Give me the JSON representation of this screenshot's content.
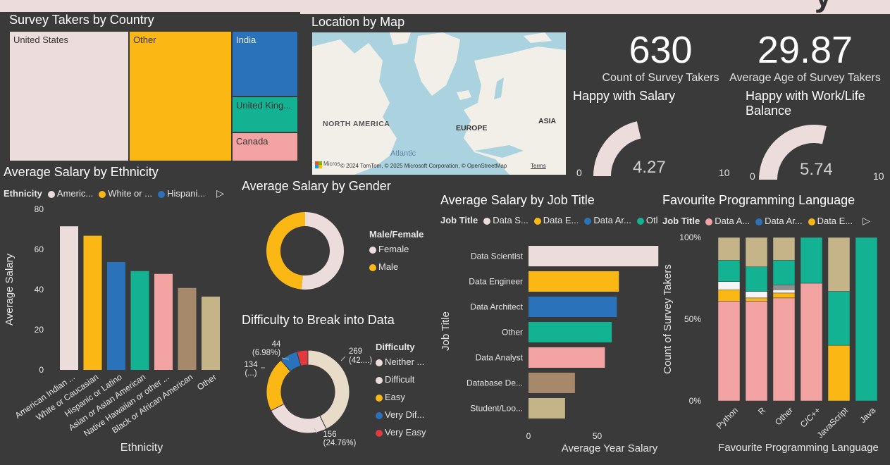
{
  "header": {
    "partial_title": "y"
  },
  "colors": {
    "c1": "#ecdcdc",
    "c2": "#fbb714",
    "c3": "#2a72ba",
    "c4": "#12b292",
    "c5": "#f4a3a3",
    "c6": "#a5896a",
    "c7": "#c5b487",
    "bg": "#3a3a3a"
  },
  "treemap": {
    "title": "Survey Takers by Country",
    "items": [
      "United States",
      "Other",
      "India",
      "United King...",
      "Canada"
    ]
  },
  "map": {
    "title": "Location by Map",
    "labels": [
      "NORTH AMERICA",
      "EUROPE",
      "ASIA",
      "Atlantic"
    ],
    "attribution": "© 2024 TomTom, © 2025 Microsoft Corporation, © OpenStreetMap",
    "terms": "Terms",
    "logo": "Micros"
  },
  "kpis": [
    {
      "value": "630",
      "label": "Count of Survey Takers"
    },
    {
      "value": "29.87",
      "label": "Average Age of Survey Takers"
    }
  ],
  "gauges": [
    {
      "title": "Happy with Salary",
      "value": 4.27,
      "value_text": "4.27",
      "min": "0",
      "max": "10"
    },
    {
      "title": "Happy with Work/Life Balance",
      "value": 5.74,
      "value_text": "5.74",
      "min": "0",
      "max": "10"
    }
  ],
  "ethnicity_chart": {
    "title": "Average Salary by Ethnicity",
    "legend_title": "Ethnicity",
    "legend_items": [
      "Americ...",
      "White or ...",
      "Hispani..."
    ],
    "xlabel": "Ethnicity",
    "ylabel": "Average Salary"
  },
  "gender_chart": {
    "title": "Average Salary by Gender",
    "legend_title": "Male/Female",
    "legend_items": [
      "Female",
      "Male"
    ]
  },
  "difficulty_chart": {
    "title": "Difficulty to Break into Data",
    "legend_title": "Difficulty",
    "legend_items": [
      "Neither ...",
      "Difficult",
      "Easy",
      "Very Dif...",
      "Very Easy"
    ],
    "labels": [
      "44",
      "(6.98%)",
      "134",
      "(...)",
      "269",
      "(42....)",
      "156",
      "(24.76%)"
    ]
  },
  "job_chart": {
    "title": "Average Salary by Job Title",
    "legend_title": "Job Title",
    "legend_items": [
      "Data S...",
      "Data E...",
      "Data Ar...",
      "Otl"
    ],
    "xlabel": "Average Year Salary",
    "ylabel": "Job Title"
  },
  "lang_chart": {
    "title": "Favourite Programming Language",
    "legend_title": "Job Title",
    "legend_items": [
      "Data A...",
      "Data Ar...",
      "Data E..."
    ],
    "xlabel": "Favourite Programming Language",
    "ylabel": "Count of Survey Takers"
  },
  "chart_data": [
    {
      "type": "bar",
      "title": "Average Salary by Ethnicity",
      "xlabel": "Ethnicity",
      "ylabel": "Average Salary",
      "ylim": [
        0,
        80
      ],
      "yticks": [
        0,
        20,
        40,
        60,
        80
      ],
      "categories": [
        "American Indian ...",
        "White or Caucasian",
        "Hispanic or Latino",
        "Asian or Asian American",
        "Native Hawaiian or other ...",
        "Black or African American",
        "Other"
      ],
      "values": [
        71.5,
        66.8,
        53.7,
        49.2,
        47.8,
        40.8,
        36.5
      ]
    },
    {
      "type": "pie",
      "title": "Average Salary by Gender",
      "categories": [
        "Female",
        "Male"
      ],
      "values": [
        51.5,
        48.5
      ]
    },
    {
      "type": "pie",
      "title": "Difficulty to Break into Data",
      "categories": [
        "Neither easy nor difficult",
        "Difficult",
        "Easy",
        "Very Difficult",
        "Very Easy"
      ],
      "values": [
        269,
        156,
        134,
        44,
        27
      ]
    },
    {
      "type": "bar",
      "title": "Average Salary by Job Title",
      "orientation": "horizontal",
      "xlabel": "Average Year Salary",
      "ylabel": "Job Title",
      "xlim": [
        0,
        100
      ],
      "xticks": [
        0,
        50
      ],
      "categories": [
        "Data Scientist",
        "Data Engineer",
        "Data Architect",
        "Other",
        "Data Analyst",
        "Database De...",
        "Student/Loo..."
      ],
      "values": [
        94.5,
        65.8,
        64.3,
        60.6,
        55.6,
        33.8,
        26.6
      ]
    },
    {
      "type": "bar",
      "stacked": "percent",
      "title": "Favourite Programming Language",
      "xlabel": "Favourite Programming Language",
      "ylabel": "Count of Survey Takers",
      "yticks": [
        "0%",
        "50%",
        "100%"
      ],
      "categories": [
        "Python",
        "R",
        "Other",
        "C/C++",
        "JavaScript",
        "Java"
      ],
      "series": [
        {
          "name": "Data A...",
          "values": [
            61,
            61,
            63,
            72,
            0,
            0
          ]
        },
        {
          "name": "Data E...",
          "values": [
            7,
            2,
            3,
            0,
            34,
            0
          ]
        },
        {
          "name": "",
          "values": [
            5,
            4,
            2,
            0,
            0,
            0
          ]
        },
        {
          "name": "",
          "values": [
            0,
            0,
            3,
            0,
            0,
            0
          ]
        },
        {
          "name": "",
          "values": [
            13,
            15,
            15,
            28,
            33,
            100
          ]
        },
        {
          "name": "",
          "values": [
            14,
            18,
            14,
            0,
            33,
            0
          ]
        }
      ]
    }
  ]
}
